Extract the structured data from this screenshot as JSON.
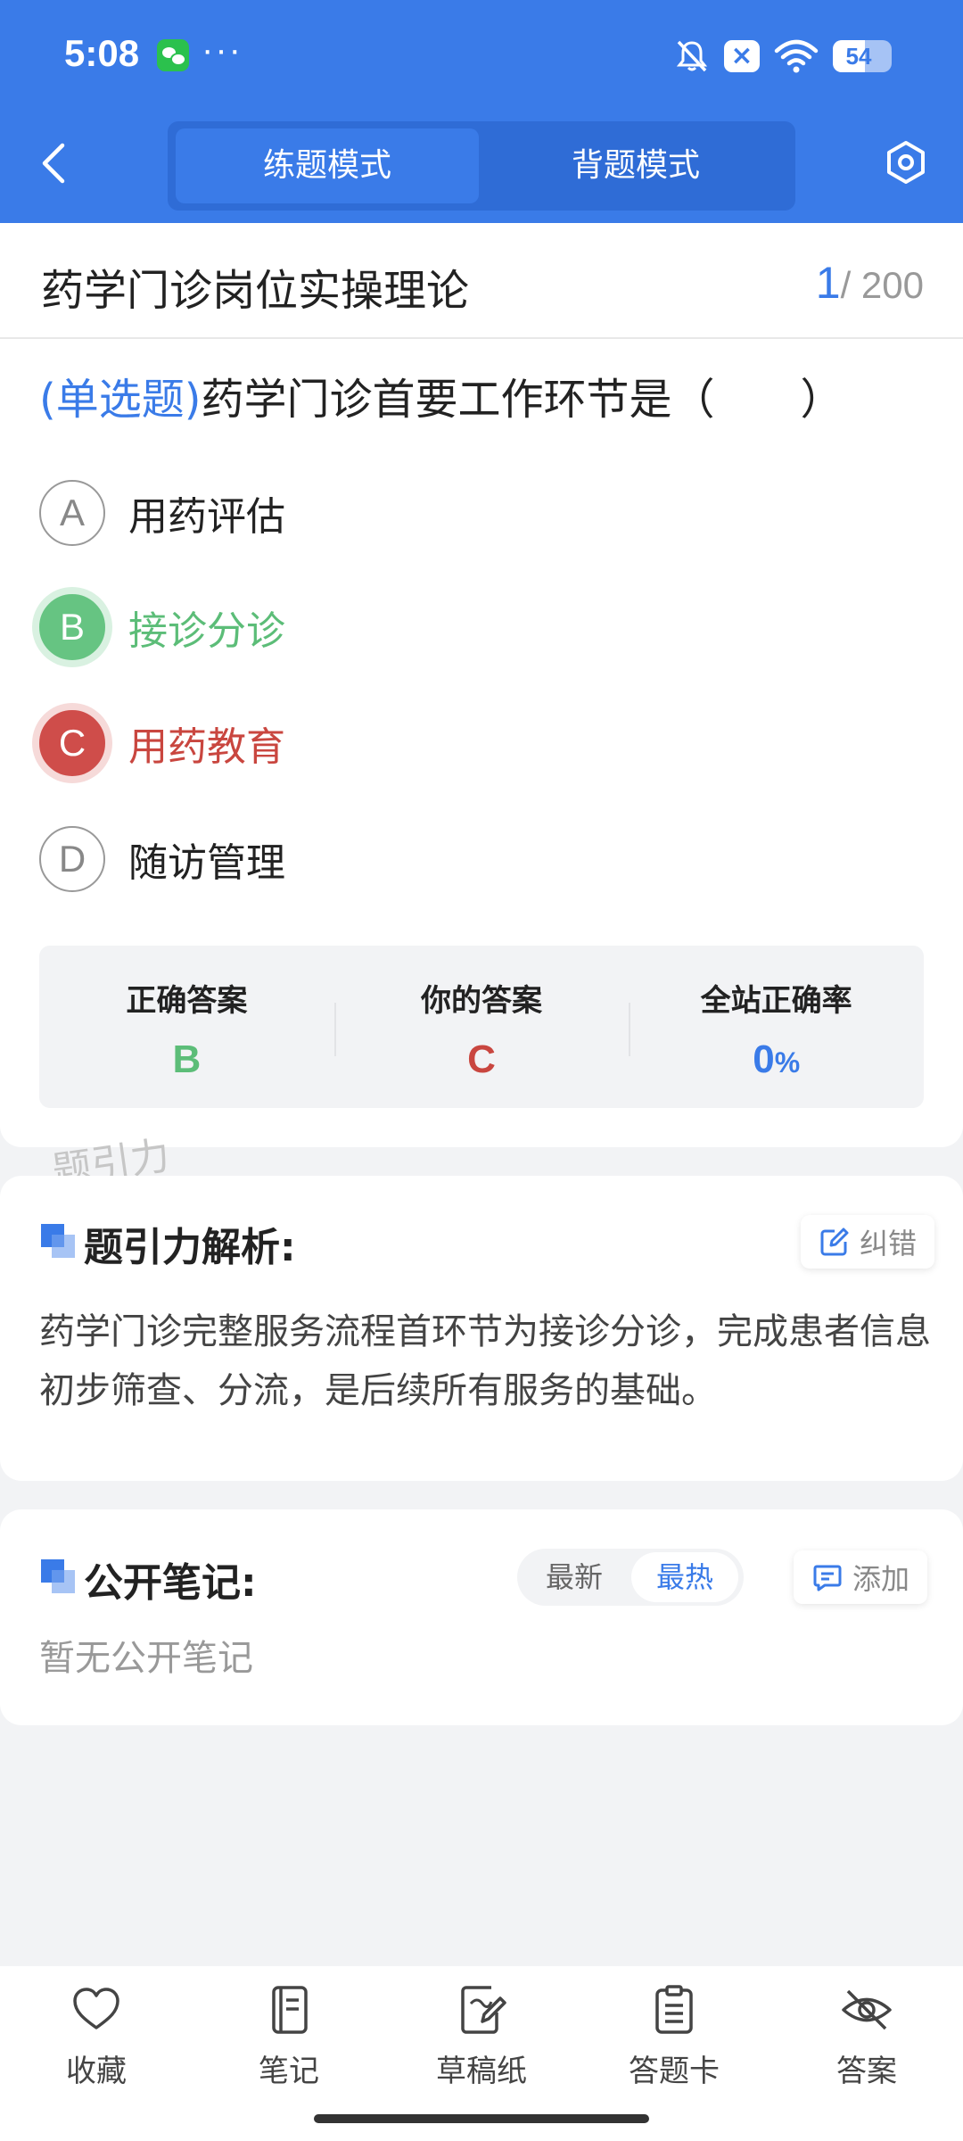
{
  "status_bar": {
    "time": "5:08",
    "more": "···",
    "battery": "54",
    "battery_level": 0.54
  },
  "header": {
    "tabs": [
      {
        "label": "练题模式",
        "active": true
      },
      {
        "label": "背题模式",
        "active": false
      }
    ]
  },
  "question": {
    "bank_title": "药学门诊岗位实操理论",
    "current": "1",
    "total": "/ 200",
    "type_tag": "(单选题)",
    "text": "药学门诊首要工作环节是（　　）",
    "options": [
      {
        "letter": "A",
        "text": "用药评估",
        "state": "normal"
      },
      {
        "letter": "B",
        "text": "接诊分诊",
        "state": "correct"
      },
      {
        "letter": "C",
        "text": "用药教育",
        "state": "wrong"
      },
      {
        "letter": "D",
        "text": "随访管理",
        "state": "normal"
      }
    ]
  },
  "result": {
    "correct_label": "正确答案",
    "correct_value": "B",
    "yours_label": "你的答案",
    "yours_value": "C",
    "rate_label": "全站正确率",
    "rate_value": "0",
    "rate_unit": "%"
  },
  "watermark": "题引力",
  "analysis": {
    "title": "题引力解析:",
    "report_label": "纠错",
    "text": "药学门诊完整服务流程首环节为接诊分诊，完成患者信息初步筛查、分流，是后续所有服务的基础。"
  },
  "notes": {
    "title": "公开笔记:",
    "sort_newest": "最新",
    "sort_hottest": "最热",
    "add_label": "添加",
    "empty_text": "暂无公开笔记"
  },
  "bottom_nav": [
    {
      "label": "收藏",
      "icon": "heart-icon"
    },
    {
      "label": "笔记",
      "icon": "notebook-icon"
    },
    {
      "label": "草稿纸",
      "icon": "draft-paper-icon"
    },
    {
      "label": "答题卡",
      "icon": "answer-card-icon"
    },
    {
      "label": "答案",
      "icon": "eye-off-icon"
    }
  ],
  "colors": {
    "primary": "#3a7be8",
    "correct": "#66c482",
    "wrong": "#cf4d4a",
    "background": "#f2f3f5"
  }
}
